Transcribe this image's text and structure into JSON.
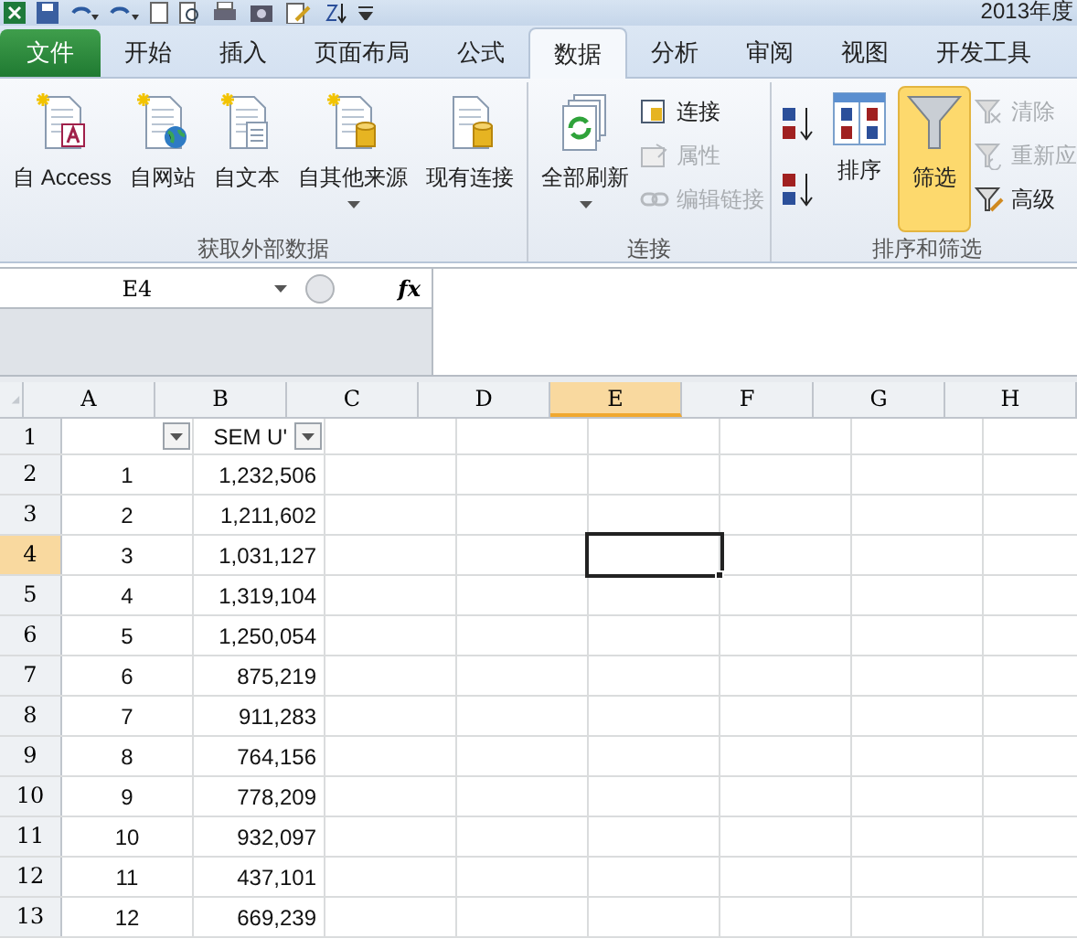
{
  "title": "2013年度",
  "tabs": [
    {
      "label": "文件",
      "kind": "file",
      "selected": false
    },
    {
      "label": "开始",
      "kind": "tab",
      "selected": false
    },
    {
      "label": "插入",
      "kind": "tab",
      "selected": false
    },
    {
      "label": "页面布局",
      "kind": "tab",
      "selected": false
    },
    {
      "label": "公式",
      "kind": "tab",
      "selected": false
    },
    {
      "label": "数据",
      "kind": "tab",
      "selected": true
    },
    {
      "label": "分析",
      "kind": "tab",
      "selected": false
    },
    {
      "label": "审阅",
      "kind": "tab",
      "selected": false
    },
    {
      "label": "视图",
      "kind": "tab",
      "selected": false
    },
    {
      "label": "开发工具",
      "kind": "tab",
      "selected": false
    }
  ],
  "groups": [
    {
      "label": "获取外部数据",
      "items": [
        {
          "kind": "large",
          "label": "自 Access",
          "dropdown": false,
          "selected": false,
          "disabled": false
        },
        {
          "kind": "large",
          "label": "自网站",
          "dropdown": false,
          "selected": false,
          "disabled": false
        },
        {
          "kind": "large",
          "label": "自文本",
          "dropdown": false,
          "selected": false,
          "disabled": false
        },
        {
          "kind": "large",
          "label": "自其他来源",
          "dropdown": true,
          "selected": false,
          "disabled": false
        },
        {
          "kind": "large",
          "label": "现有连接",
          "dropdown": false,
          "selected": false,
          "disabled": false
        }
      ]
    },
    {
      "label": "连接",
      "items": [
        {
          "kind": "large",
          "label": "全部刷新",
          "dropdown": true,
          "selected": false,
          "disabled": false
        },
        {
          "kind": "small",
          "label": "连接",
          "disabled": false
        },
        {
          "kind": "small",
          "label": "属性",
          "disabled": true
        },
        {
          "kind": "small",
          "label": "编辑链接",
          "disabled": true
        }
      ]
    },
    {
      "label": "排序和筛选",
      "items": [
        {
          "kind": "sortpair"
        },
        {
          "kind": "large",
          "label": "排序",
          "dropdown": false,
          "selected": false,
          "disabled": false
        },
        {
          "kind": "large",
          "label": "筛选",
          "dropdown": false,
          "selected": true,
          "disabled": false
        },
        {
          "kind": "small",
          "label": "清除",
          "disabled": true
        },
        {
          "kind": "small",
          "label": "重新应",
          "disabled": true
        },
        {
          "kind": "small",
          "label": "高级",
          "disabled": false
        }
      ]
    }
  ],
  "name_box": "E4",
  "fx": "fx",
  "columns": [
    {
      "label": "A",
      "selected": false
    },
    {
      "label": "B",
      "selected": false
    },
    {
      "label": "C",
      "selected": false
    },
    {
      "label": "D",
      "selected": false
    },
    {
      "label": "E",
      "selected": true
    },
    {
      "label": "F",
      "selected": false
    },
    {
      "label": "G",
      "selected": false
    },
    {
      "label": "H",
      "selected": false
    }
  ],
  "rows": [
    {
      "header": "1",
      "selected": false,
      "cells": [
        {
          "text": "",
          "filter": true
        },
        {
          "text": "SEM U'",
          "filter": true
        }
      ]
    },
    {
      "header": "2",
      "selected": false,
      "cells": [
        {
          "text": "1"
        },
        {
          "text": "1,232,506"
        }
      ]
    },
    {
      "header": "3",
      "selected": false,
      "cells": [
        {
          "text": "2"
        },
        {
          "text": "1,211,602"
        }
      ]
    },
    {
      "header": "4",
      "selected": true,
      "cells": [
        {
          "text": "3"
        },
        {
          "text": "1,031,127"
        }
      ]
    },
    {
      "header": "5",
      "selected": false,
      "cells": [
        {
          "text": "4"
        },
        {
          "text": "1,319,104"
        }
      ]
    },
    {
      "header": "6",
      "selected": false,
      "cells": [
        {
          "text": "5"
        },
        {
          "text": "1,250,054"
        }
      ]
    },
    {
      "header": "7",
      "selected": false,
      "cells": [
        {
          "text": "6"
        },
        {
          "text": "875,219"
        }
      ]
    },
    {
      "header": "8",
      "selected": false,
      "cells": [
        {
          "text": "7"
        },
        {
          "text": "911,283"
        }
      ]
    },
    {
      "header": "9",
      "selected": false,
      "cells": [
        {
          "text": "8"
        },
        {
          "text": "764,156"
        }
      ]
    },
    {
      "header": "10",
      "selected": false,
      "cells": [
        {
          "text": "9"
        },
        {
          "text": "778,209"
        }
      ]
    },
    {
      "header": "11",
      "selected": false,
      "cells": [
        {
          "text": "10"
        },
        {
          "text": "932,097"
        }
      ]
    },
    {
      "header": "12",
      "selected": false,
      "cells": [
        {
          "text": "11"
        },
        {
          "text": "437,101"
        }
      ]
    },
    {
      "header": "13",
      "selected": false,
      "cells": [
        {
          "text": "12"
        },
        {
          "text": "669,239"
        }
      ]
    }
  ]
}
